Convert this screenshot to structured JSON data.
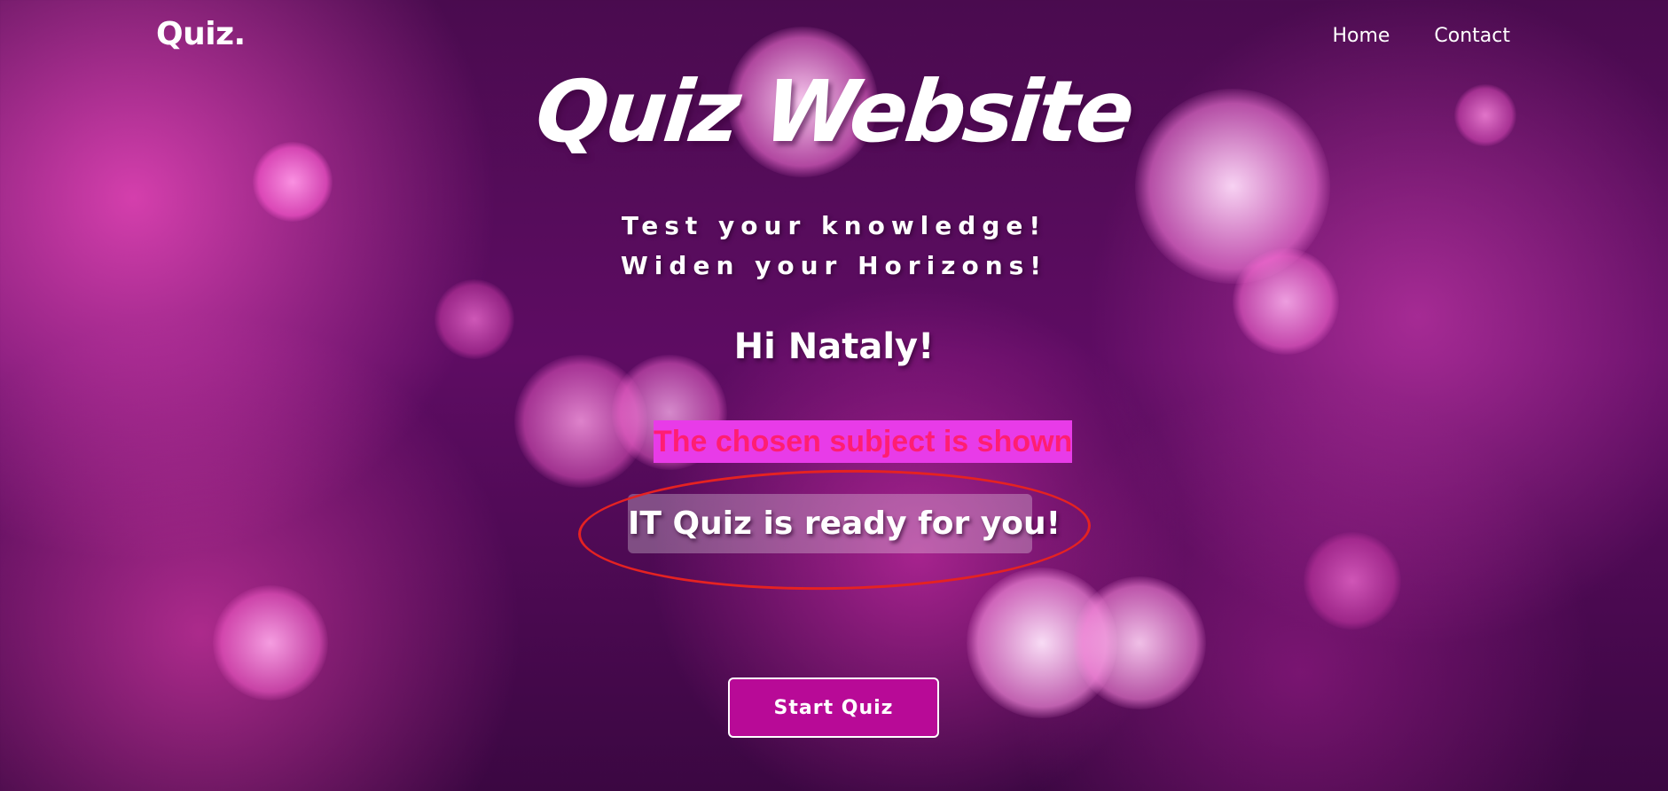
{
  "navbar": {
    "logo": "Quiz.",
    "links": [
      {
        "label": "Home"
      },
      {
        "label": "Contact"
      }
    ]
  },
  "hero": {
    "title": "Quiz Website",
    "tagline_line1": "Test your knowledge!",
    "tagline_line2": "Widen your Horizons!"
  },
  "greeting": "Hi Nataly!",
  "annotation": {
    "callout_text": "The chosen subject is shown",
    "callout_bg_color": "#e83be8",
    "callout_text_color": "#ff1e72",
    "ellipse_color": "#e52222"
  },
  "quiz_status": "IT Quiz is ready for you!",
  "start_button": {
    "label": "Start Quiz",
    "color": "#b80a97"
  }
}
